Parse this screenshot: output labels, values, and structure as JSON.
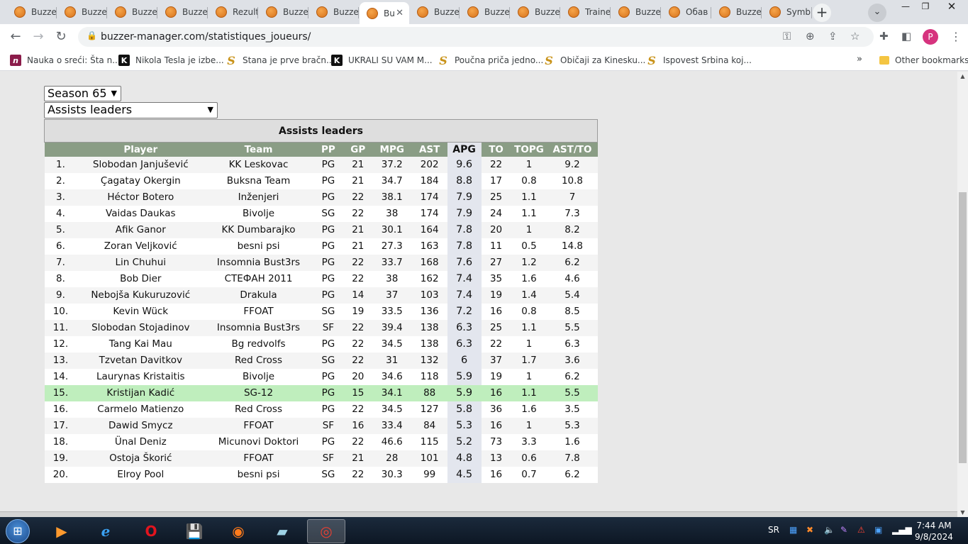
{
  "browser": {
    "tabs": [
      {
        "title": "Buzze",
        "active": false
      },
      {
        "title": "Buzze",
        "active": false
      },
      {
        "title": "Buzze",
        "active": false
      },
      {
        "title": "Buzze",
        "active": false
      },
      {
        "title": "Rezult",
        "active": false
      },
      {
        "title": "Buzze",
        "active": false
      },
      {
        "title": "Buzze",
        "active": false
      },
      {
        "title": "Bu",
        "active": true
      },
      {
        "title": "Buzze",
        "active": false
      },
      {
        "title": "Buzze",
        "active": false
      },
      {
        "title": "Buzze",
        "active": false
      },
      {
        "title": "Traine",
        "active": false
      },
      {
        "title": "Buzze",
        "active": false
      },
      {
        "title": "Обав",
        "active": false
      },
      {
        "title": "Buzze",
        "active": false
      },
      {
        "title": "Symb",
        "active": false
      }
    ],
    "url": "buzzer-manager.com/statistiques_joueurs/",
    "bookmarks": [
      {
        "label": "Nauka o sreći: Šta n...",
        "icon": "n"
      },
      {
        "label": "Nikola Tesla je izbe...",
        "icon": "k"
      },
      {
        "label": "Stana je prve bračn...",
        "icon": "s"
      },
      {
        "label": "UKRALI SU VAM M...",
        "icon": "k"
      },
      {
        "label": "Poučna priča jedno...",
        "icon": "s"
      },
      {
        "label": "Običaji za Kinesku...",
        "icon": "s"
      },
      {
        "label": "Ispovest Srbina koj...",
        "icon": "s"
      }
    ],
    "bookmarks_more": "»",
    "other_bookmarks": "Other bookmarks",
    "profile_initial": "P"
  },
  "filters": {
    "season": "Season 65",
    "category": "Assists leaders"
  },
  "table": {
    "caption": "Assists leaders",
    "headers": [
      "",
      "Player",
      "Team",
      "PP",
      "GP",
      "MPG",
      "AST",
      "APG",
      "TO",
      "TOPG",
      "AST/TO"
    ],
    "rows": [
      [
        "1.",
        "Slobodan Janjušević",
        "KK Leskovac",
        "PG",
        "21",
        "37.2",
        "202",
        "9.6",
        "22",
        "1",
        "9.2"
      ],
      [
        "2.",
        "Çagatay Okergin",
        "Buksna Team",
        "PG",
        "21",
        "34.7",
        "184",
        "8.8",
        "17",
        "0.8",
        "10.8"
      ],
      [
        "3.",
        "Héctor Botero",
        "Inženjeri",
        "PG",
        "22",
        "38.1",
        "174",
        "7.9",
        "25",
        "1.1",
        "7"
      ],
      [
        "4.",
        "Vaidas Daukas",
        "Bivolje",
        "SG",
        "22",
        "38",
        "174",
        "7.9",
        "24",
        "1.1",
        "7.3"
      ],
      [
        "5.",
        "Afik Ganor",
        "KK Dumbarajko",
        "PG",
        "21",
        "30.1",
        "164",
        "7.8",
        "20",
        "1",
        "8.2"
      ],
      [
        "6.",
        "Zoran Veljković",
        "besni psi",
        "PG",
        "21",
        "27.3",
        "163",
        "7.8",
        "11",
        "0.5",
        "14.8"
      ],
      [
        "7.",
        "Lin Chuhui",
        "Insomnia Bust3rs",
        "PG",
        "22",
        "33.7",
        "168",
        "7.6",
        "27",
        "1.2",
        "6.2"
      ],
      [
        "8.",
        "Bob Dier",
        "СТЕФАН 2011",
        "PG",
        "22",
        "38",
        "162",
        "7.4",
        "35",
        "1.6",
        "4.6"
      ],
      [
        "9.",
        "Nebojša Kukuruzović",
        "Drakula",
        "PG",
        "14",
        "37",
        "103",
        "7.4",
        "19",
        "1.4",
        "5.4"
      ],
      [
        "10.",
        "Kevin Wück",
        "FFOAT",
        "SG",
        "19",
        "33.5",
        "136",
        "7.2",
        "16",
        "0.8",
        "8.5"
      ],
      [
        "11.",
        "Slobodan Stojadinov",
        "Insomnia Bust3rs",
        "SF",
        "22",
        "39.4",
        "138",
        "6.3",
        "25",
        "1.1",
        "5.5"
      ],
      [
        "12.",
        "Tang Kai Mau",
        "Bg redvolfs",
        "PG",
        "22",
        "34.5",
        "138",
        "6.3",
        "22",
        "1",
        "6.3"
      ],
      [
        "13.",
        "Tzvetan Davitkov",
        "Red Cross",
        "SG",
        "22",
        "31",
        "132",
        "6",
        "37",
        "1.7",
        "3.6"
      ],
      [
        "14.",
        "Laurynas Kristaitis",
        "Bivolje",
        "PG",
        "20",
        "34.6",
        "118",
        "5.9",
        "19",
        "1",
        "6.2"
      ],
      [
        "15.",
        "Kristijan Kadić",
        "SG-12",
        "PG",
        "15",
        "34.1",
        "88",
        "5.9",
        "16",
        "1.1",
        "5.5"
      ],
      [
        "16.",
        "Carmelo Matienzo",
        "Red Cross",
        "PG",
        "22",
        "34.5",
        "127",
        "5.8",
        "36",
        "1.6",
        "3.5"
      ],
      [
        "17.",
        "Dawid Smycz",
        "FFOAT",
        "SF",
        "16",
        "33.4",
        "84",
        "5.3",
        "16",
        "1",
        "5.3"
      ],
      [
        "18.",
        "Ünal Deniz",
        "Micunovi Doktori",
        "PG",
        "22",
        "46.6",
        "115",
        "5.2",
        "73",
        "3.3",
        "1.6"
      ],
      [
        "19.",
        "Ostoja Škorić",
        "FFOAT",
        "SF",
        "21",
        "28",
        "101",
        "4.8",
        "13",
        "0.6",
        "7.8"
      ],
      [
        "20.",
        "Elroy Pool",
        "besni psi",
        "SG",
        "22",
        "30.3",
        "99",
        "4.5",
        "16",
        "0.7",
        "6.2"
      ]
    ],
    "highlighted_rank": "15."
  },
  "taskbar": {
    "language": "SR",
    "time": "7:44 AM",
    "date": "9/8/2024"
  },
  "colors": {
    "header_green": "#8a9d85",
    "highlight_row": "#bfeebd",
    "sorted_col": "#e3e6ee",
    "profile": "#d6337e"
  }
}
